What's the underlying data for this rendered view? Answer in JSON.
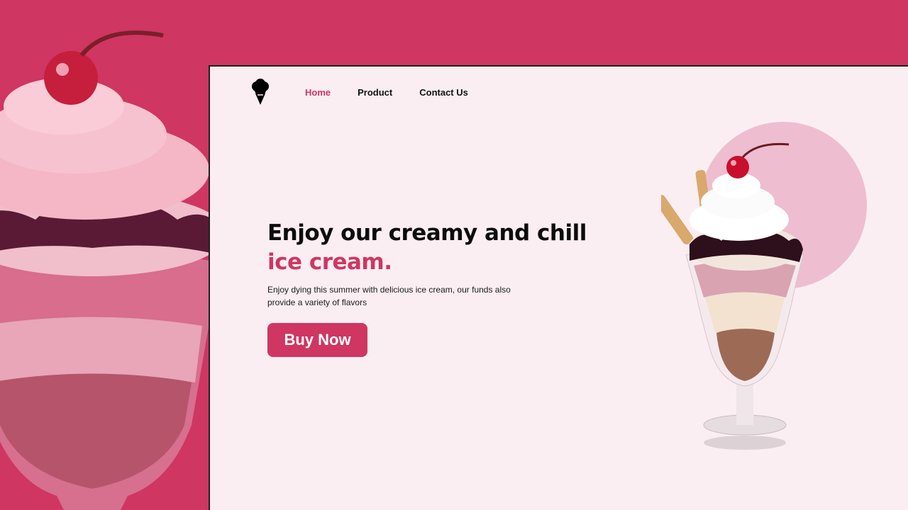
{
  "nav": {
    "logo_icon": "ice-cream-logo-icon",
    "links": [
      {
        "label": "Home",
        "active": true
      },
      {
        "label": "Product",
        "active": false
      },
      {
        "label": "Contact Us",
        "active": false
      }
    ]
  },
  "hero": {
    "headline": "Enjoy our creamy and chill",
    "headline_accent": "ice cream.",
    "subtext": "Enjoy dying this summer with delicious ice cream, our funds also provide a variety of flavors",
    "cta_label": "Buy Now"
  },
  "colors": {
    "brand": "#cf3661",
    "page_bg": "#fbeef2",
    "circle": "#efbdd0",
    "text": "#0c0c0c"
  }
}
